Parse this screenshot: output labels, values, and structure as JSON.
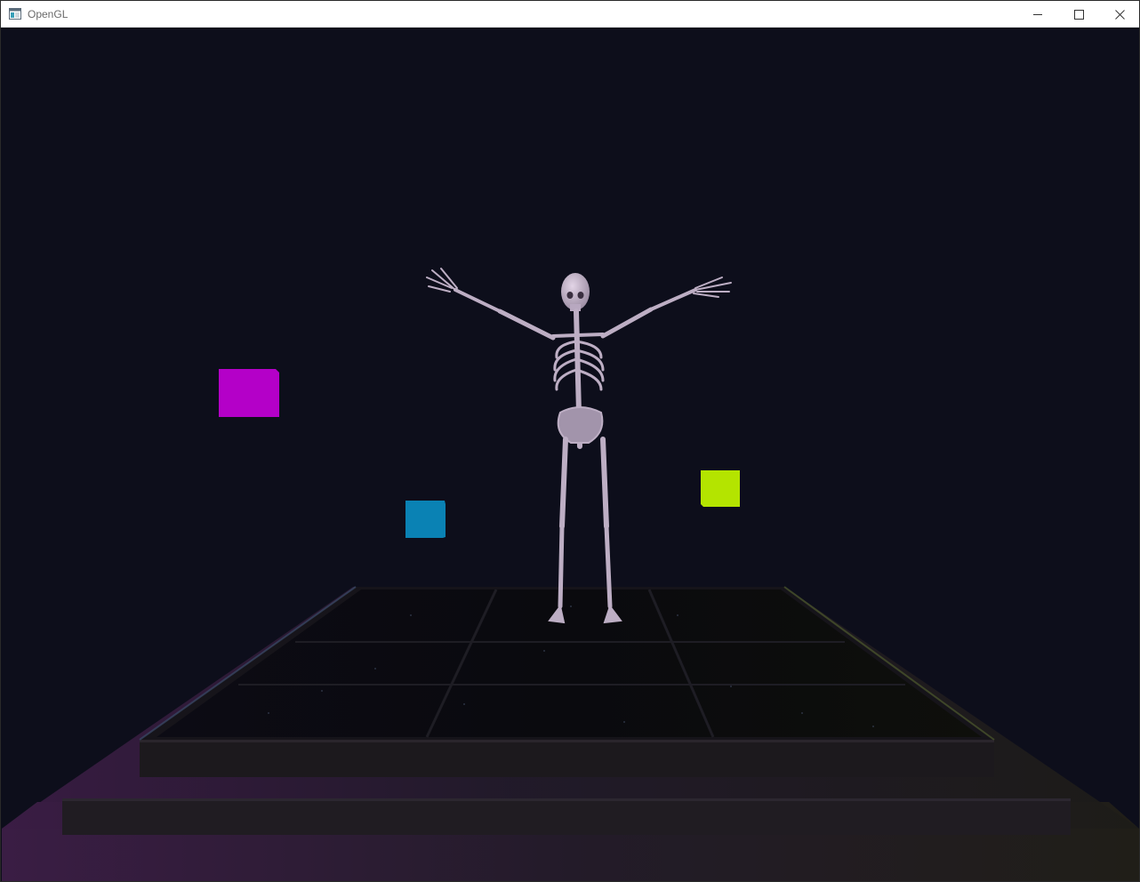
{
  "window": {
    "title": "OpenGL",
    "controls": [
      "minimize",
      "maximize",
      "close"
    ]
  },
  "icons": {
    "app": "opengl-window-icon",
    "minimize": "minimize-icon",
    "maximize": "maximize-icon",
    "close": "close-icon"
  },
  "scene": {
    "background_color": "#0d0e1b",
    "light_cubes": [
      {
        "name": "magenta",
        "color": "#b400c8"
      },
      {
        "name": "blue",
        "color": "#0a82b4"
      },
      {
        "name": "lime",
        "color": "#b4e400"
      }
    ],
    "model": "skeleton",
    "model_color": "#c7b8cc"
  }
}
